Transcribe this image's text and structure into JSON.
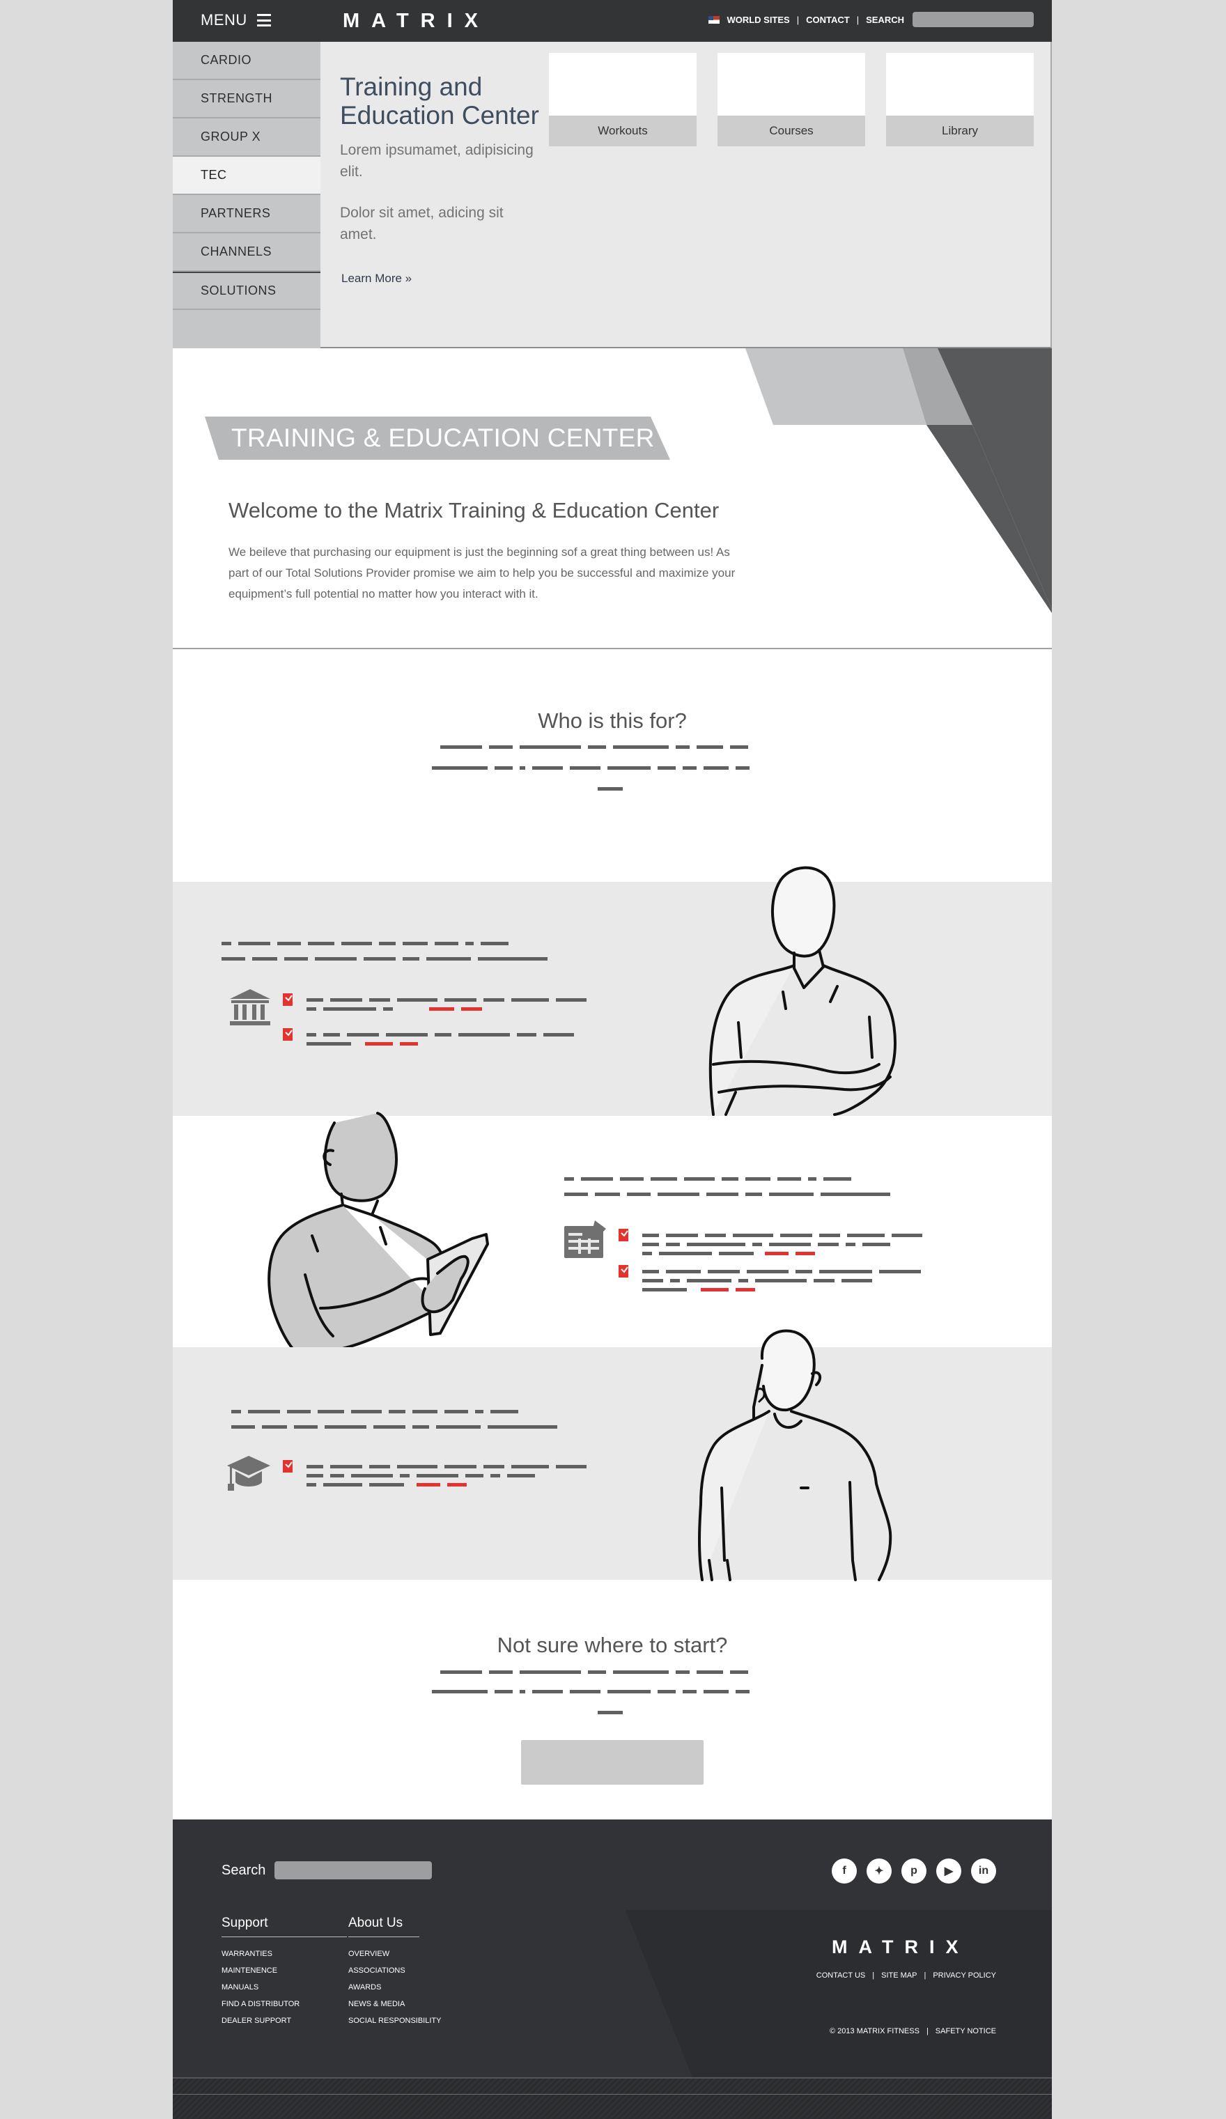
{
  "header": {
    "menu_label": "MENU",
    "brand": "MATRIX",
    "links": [
      "WORLD SITES",
      "CONTACT",
      "SEARCH"
    ],
    "separator": "|"
  },
  "nav": {
    "items": [
      {
        "label": "CARDIO"
      },
      {
        "label": "STRENGTH"
      },
      {
        "label": "GROUP X"
      },
      {
        "label": "TEC"
      },
      {
        "label": "PARTNERS"
      },
      {
        "label": "CHANNELS"
      },
      {
        "label": "SOLUTIONS"
      }
    ],
    "active": "TEC"
  },
  "hero": {
    "title": "Training and Education Center",
    "paragraph1": "Lorem ipsumamet, adipisicing elit.",
    "paragraph2": "Dolor sit amet, adicing sit amet.",
    "learn_more": "Learn More",
    "cards": [
      {
        "label": "Workouts"
      },
      {
        "label": "Courses"
      },
      {
        "label": "Library"
      }
    ]
  },
  "intro": {
    "banner": "TRAINING & EDUCATION CENTER",
    "heading": "Welcome to the Matrix Training & Education Center",
    "body": "We beileve that purchasing our equipment is just the beginning sof a great thing between us! As part of our Total Solutions Provider promise we aim to help you be successful and maximize your equipment’s full potential no matter how you interact with it."
  },
  "who": {
    "heading": "Who is this for?"
  },
  "personas": [
    {
      "icon": "bank-icon"
    },
    {
      "icon": "clipboard-icon"
    },
    {
      "icon": "graduation-cap-icon"
    }
  ],
  "cta": {
    "heading": "Not sure where to start?"
  },
  "footer": {
    "search_label": "Search",
    "support_heading": "Support",
    "support_links": [
      "WARRANTIES",
      "MAINTENENCE",
      "MANUALS",
      "FIND A DISTRIBUTOR",
      "DEALER SUPPORT"
    ],
    "about_heading": "About Us",
    "about_links": [
      "OVERVIEW",
      "ASSOCIATIONS",
      "AWARDS",
      "NEWS & MEDIA",
      "SOCIAL RESPONSIBILITY"
    ],
    "socials": [
      "facebook-icon",
      "twitter-icon",
      "pinterest-icon",
      "youtube-icon",
      "linkedin-icon"
    ],
    "brand": "MATRIX",
    "links": [
      "CONTACT US",
      "SITE MAP",
      "PRIVACY POLICY"
    ],
    "copyright": "© 2013 MATRIX FITNESS",
    "safety": "SAFETY NOTICE",
    "separator": "|"
  },
  "colors": {
    "topbar": "#333436",
    "nav": "#c5c6c8",
    "hero_bg": "#e9e9ea",
    "band_gray": "#e9e9ea",
    "footer": "#323336",
    "accent_red": "#e2332e",
    "dash": "#606060"
  }
}
